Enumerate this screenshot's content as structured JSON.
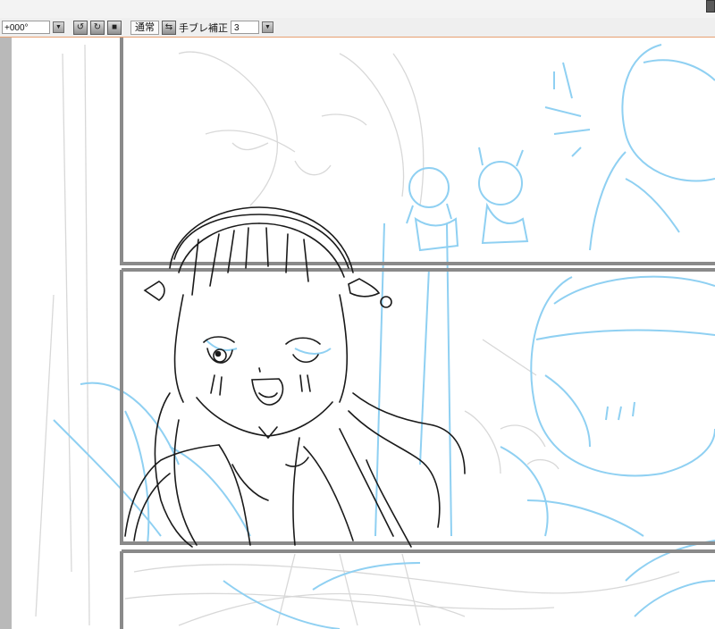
{
  "toolbar": {
    "angle_value": "+000°",
    "blend_mode": "通常",
    "stabilizer_label": "手ブレ補正",
    "stabilizer_value": "3"
  },
  "colors": {
    "toolbar_bg": "#efefef",
    "accent_border": "#e8a070",
    "sketch_blue": "#8fd0f2",
    "lineart": "#1a1a1a",
    "panel_border": "#8a8a8a"
  },
  "icons": [
    "dropdown-arrow-icon",
    "rotate-left-icon",
    "rotate-right-icon",
    "reset-square-icon",
    "swap-icon"
  ]
}
